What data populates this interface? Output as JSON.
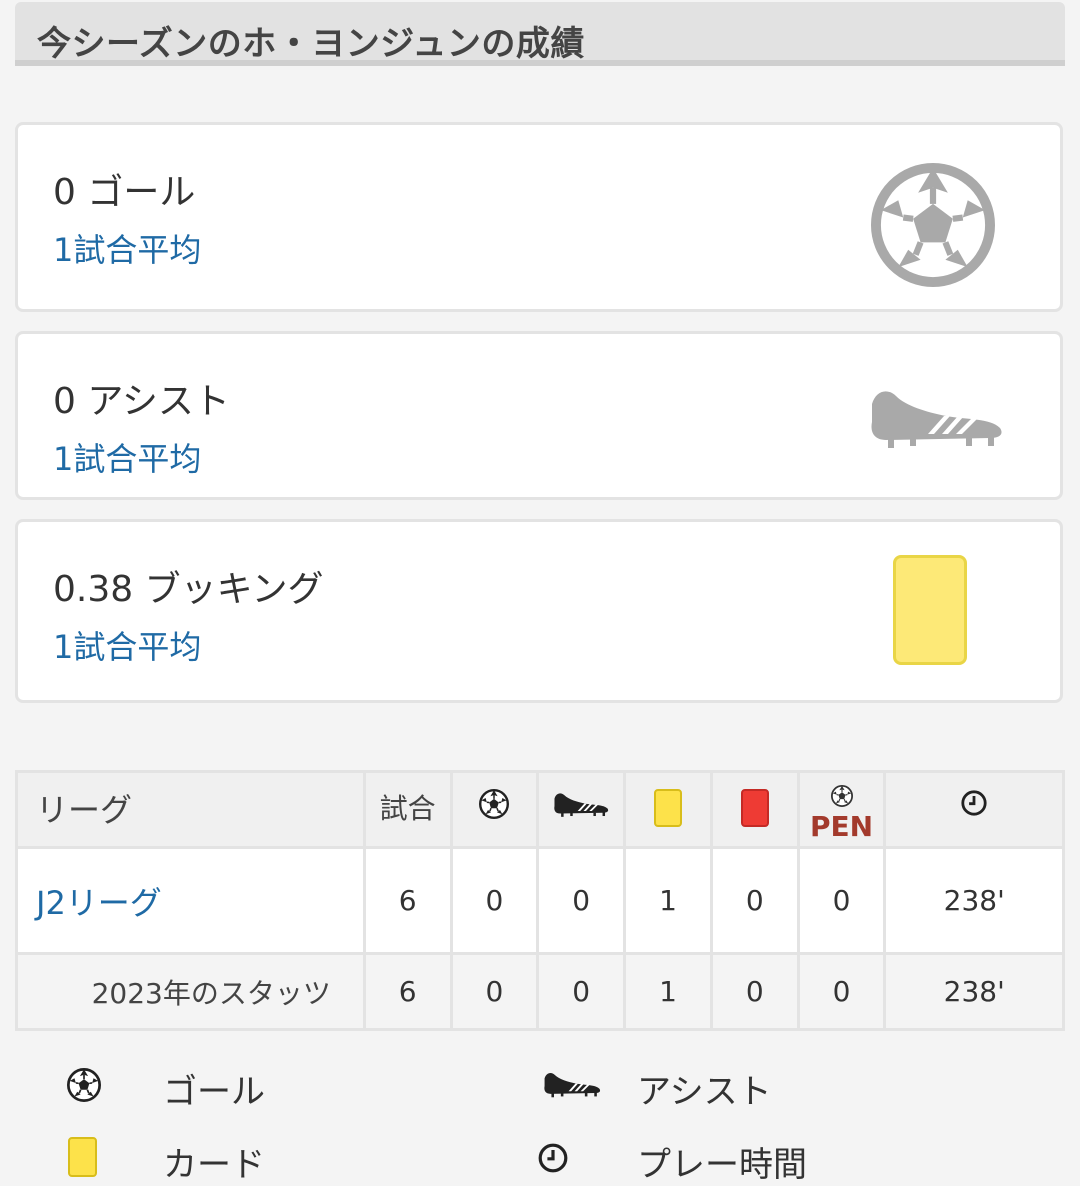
{
  "header": {
    "title": "今シーズンのホ・ヨンジュンの成績"
  },
  "cards": [
    {
      "value": "0 ゴール",
      "sub": "1試合平均",
      "icon": "soccer-ball-icon"
    },
    {
      "value": "0 アシスト",
      "sub": "1試合平均",
      "icon": "boot-icon"
    },
    {
      "value": "0.38 ブッキング",
      "sub": "1試合平均",
      "icon": "yellow-card-icon"
    }
  ],
  "table": {
    "headers": {
      "league": "リーグ",
      "games": "試合",
      "pen": "PEN"
    },
    "rows": [
      {
        "league": "J2リーグ",
        "games": "6",
        "goals": "0",
        "assists": "0",
        "yellow": "1",
        "red": "0",
        "pen": "0",
        "minutes": "238'"
      },
      {
        "league": "2023年のスタッツ",
        "games": "6",
        "goals": "0",
        "assists": "0",
        "yellow": "1",
        "red": "0",
        "pen": "0",
        "minutes": "238'"
      }
    ]
  },
  "legend": {
    "goal": "ゴール",
    "assist": "アシスト",
    "card": "カード",
    "time": "プレー時間"
  },
  "colors": {
    "link": "#1f6aa5",
    "yellow_card": "#fde977",
    "red_card": "#ee3b34",
    "pen": "#a33a2c"
  }
}
